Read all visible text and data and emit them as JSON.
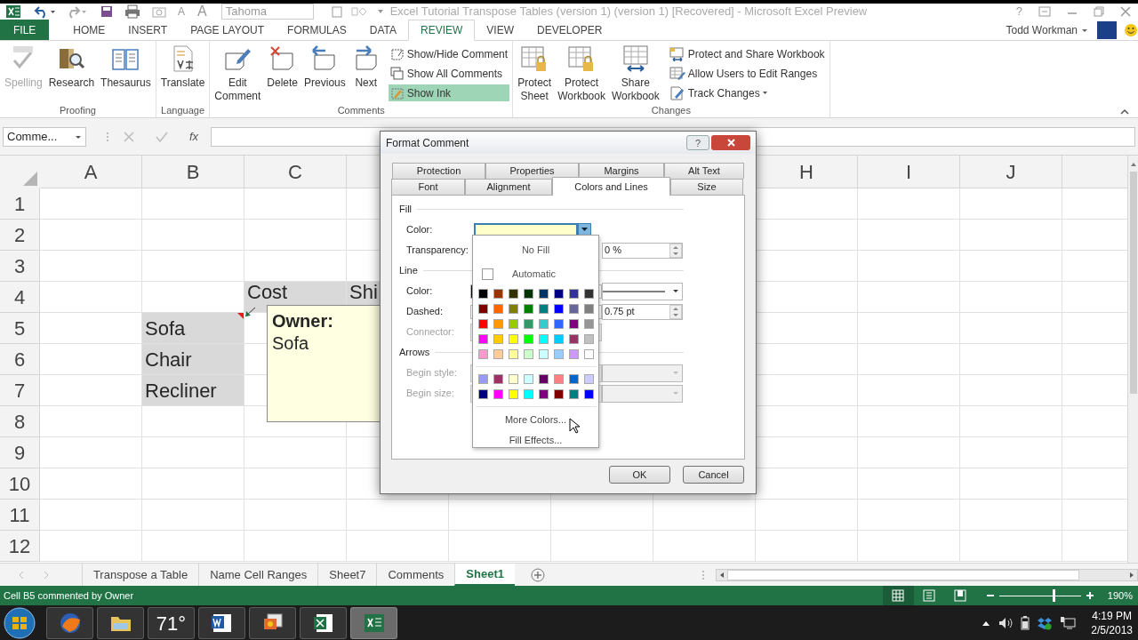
{
  "quick_access": {
    "font_shrink": "A",
    "font_grow": "A",
    "font_box": "Tahoma"
  },
  "window": {
    "title": "Excel Tutorial Transpose Tables (version 1) (version 1) [Recovered] - Microsoft Excel Preview",
    "help": "?"
  },
  "ribbon_tabs": [
    {
      "label": "FILE",
      "kind": "file",
      "selected": false
    },
    {
      "label": "HOME",
      "kind": "tab",
      "selected": false
    },
    {
      "label": "INSERT",
      "kind": "tab",
      "selected": false
    },
    {
      "label": "PAGE LAYOUT",
      "kind": "tab",
      "selected": false
    },
    {
      "label": "FORMULAS",
      "kind": "tab",
      "selected": false
    },
    {
      "label": "DATA",
      "kind": "tab",
      "selected": false
    },
    {
      "label": "REVIEW",
      "kind": "tab",
      "selected": true
    },
    {
      "label": "VIEW",
      "kind": "tab",
      "selected": false
    },
    {
      "label": "DEVELOPER",
      "kind": "tab",
      "selected": false
    }
  ],
  "account": {
    "user": "Todd Workman"
  },
  "ribbon_groups": [
    {
      "label": "Proofing",
      "buttons": [
        {
          "label": "Spelling",
          "kind": "spelling",
          "disabled": true
        },
        {
          "label": "Research",
          "kind": "research",
          "disabled": false
        },
        {
          "label": "Thesaurus",
          "kind": "thesaurus",
          "disabled": false
        }
      ]
    },
    {
      "label": "Language",
      "buttons": [
        {
          "label": "Translate",
          "kind": "translate",
          "disabled": false
        }
      ]
    },
    {
      "label": "Comments",
      "buttons": [
        {
          "label": "Edit Comment",
          "kind": "edit",
          "disabled": false
        },
        {
          "label": "Delete",
          "kind": "delete",
          "disabled": false
        },
        {
          "label": "Previous",
          "kind": "previous",
          "disabled": false
        },
        {
          "label": "Next",
          "kind": "next",
          "disabled": false
        }
      ],
      "small_buttons": [
        {
          "label": "Show/Hide Comment",
          "kind": "showhide",
          "on": false,
          "dropdown": false
        },
        {
          "label": "Show All Comments",
          "kind": "showall",
          "on": false,
          "dropdown": false
        },
        {
          "label": "Show Ink",
          "kind": "ink",
          "on": true,
          "dropdown": false
        }
      ]
    },
    {
      "label": "Changes",
      "buttons": [
        {
          "label": "Protect Sheet",
          "kind": "protect_sheet",
          "disabled": false
        },
        {
          "label": "Protect Workbook",
          "kind": "protect_book",
          "disabled": false
        },
        {
          "label": "Share Workbook",
          "kind": "share",
          "disabled": false
        }
      ],
      "small_buttons": [
        {
          "label": "Protect and Share Workbook",
          "kind": "protect_share",
          "on": false,
          "dropdown": false
        },
        {
          "label": "Allow Users to Edit Ranges",
          "kind": "ranges",
          "on": false,
          "dropdown": false
        },
        {
          "label": "Track Changes",
          "kind": "track",
          "on": false,
          "dropdown": true
        }
      ]
    }
  ],
  "formula_bar": {
    "name_box": "Comme...",
    "function_button": "fx"
  },
  "sheet": {
    "column_headers": [
      "A",
      "B",
      "C",
      "H",
      "I",
      "J"
    ],
    "rows": [
      {
        "header": "1",
        "cells": []
      },
      {
        "header": "2",
        "cells": []
      },
      {
        "header": "3",
        "cells": []
      },
      {
        "header": "4",
        "cells": [
          null,
          null,
          {
            "text": "Cost",
            "shaded": true,
            "comment_marker": false
          },
          {
            "text": "Shi",
            "shaded": true,
            "comment_marker": false
          }
        ]
      },
      {
        "header": "5",
        "cells": [
          null,
          {
            "text": "Sofa",
            "shaded": true,
            "comment_marker": true
          }
        ]
      },
      {
        "header": "6",
        "cells": [
          null,
          {
            "text": "Chair",
            "shaded": true,
            "comment_marker": false
          }
        ]
      },
      {
        "header": "7",
        "cells": [
          null,
          {
            "text": "Recliner",
            "shaded": true,
            "comment_marker": false
          }
        ]
      },
      {
        "header": "8",
        "cells": []
      },
      {
        "header": "9",
        "cells": []
      },
      {
        "header": "10",
        "cells": []
      },
      {
        "header": "11",
        "cells": []
      },
      {
        "header": "12",
        "cells": []
      }
    ],
    "comment": {
      "author": "Owner:",
      "text": "Sofa"
    }
  },
  "dialog": {
    "title": "Format Comment",
    "help": "?",
    "tab_rows": [
      [
        {
          "label": "Protection",
          "selected": false
        },
        {
          "label": "Properties",
          "selected": false
        },
        {
          "label": "Margins",
          "selected": false
        },
        {
          "label": "Alt Text",
          "selected": false
        }
      ],
      [
        {
          "label": "Font",
          "selected": false
        },
        {
          "label": "Alignment",
          "selected": false
        },
        {
          "label": "Colors and Lines",
          "selected": true
        },
        {
          "label": "Size",
          "selected": false
        }
      ]
    ],
    "fill": {
      "heading": "Fill",
      "color_label": "Color:",
      "color": "#ffffcc",
      "transparency_label": "Transparency:",
      "transparency": "0 %"
    },
    "line": {
      "heading": "Line",
      "color_label": "Color:",
      "dashed_label": "Dashed:",
      "weight": "0.75 pt",
      "connector_label": "Connector:",
      "connector_disabled": true
    },
    "arrows": {
      "heading": "Arrows",
      "begin_style_label": "Begin style:",
      "begin_size_label": "Begin size:",
      "disabled": true
    },
    "color_menu": {
      "no_fill": "No Fill",
      "automatic": "Automatic",
      "palette": [
        [
          {
            "color": "#000000"
          },
          {
            "color": "#993300"
          },
          {
            "color": "#333300"
          },
          {
            "color": "#003300"
          },
          {
            "color": "#003366"
          },
          {
            "color": "#000080"
          },
          {
            "color": "#333399"
          },
          {
            "color": "#333333"
          }
        ],
        [
          {
            "color": "#800000"
          },
          {
            "color": "#ff6600"
          },
          {
            "color": "#808000"
          },
          {
            "color": "#008000"
          },
          {
            "color": "#008080"
          },
          {
            "color": "#0000ff"
          },
          {
            "color": "#666699"
          },
          {
            "color": "#808080"
          }
        ],
        [
          {
            "color": "#ff0000"
          },
          {
            "color": "#ff9900"
          },
          {
            "color": "#99cc00"
          },
          {
            "color": "#339966"
          },
          {
            "color": "#33cccc"
          },
          {
            "color": "#3366ff"
          },
          {
            "color": "#800080"
          },
          {
            "color": "#969696"
          }
        ],
        [
          {
            "color": "#ff00ff"
          },
          {
            "color": "#ffcc00"
          },
          {
            "color": "#ffff00"
          },
          {
            "color": "#00ff00"
          },
          {
            "color": "#00ffff"
          },
          {
            "color": "#00ccff"
          },
          {
            "color": "#993366"
          },
          {
            "color": "#c0c0c0"
          }
        ],
        [
          {
            "color": "#ff99cc"
          },
          {
            "color": "#ffcc99"
          },
          {
            "color": "#ffff99"
          },
          {
            "color": "#ccffcc"
          },
          {
            "color": "#ccffff"
          },
          {
            "color": "#99ccff"
          },
          {
            "color": "#cc99ff"
          },
          {
            "color": "#ffffff"
          }
        ]
      ],
      "recent": [
        [
          {
            "color": "#9999ff"
          },
          {
            "color": "#993366"
          },
          {
            "color": "#ffffcc"
          },
          {
            "color": "#ccffff"
          },
          {
            "color": "#660066"
          },
          {
            "color": "#ff8080"
          },
          {
            "color": "#0066cc"
          },
          {
            "color": "#ccccff"
          }
        ],
        [
          {
            "color": "#000080"
          },
          {
            "color": "#ff00ff"
          },
          {
            "color": "#ffff00"
          },
          {
            "color": "#00ffff"
          },
          {
            "color": "#800080"
          },
          {
            "color": "#800000"
          },
          {
            "color": "#008080"
          },
          {
            "color": "#0000ff"
          }
        ]
      ],
      "more": "More Colors...",
      "fill_effects": "Fill Effects..."
    },
    "buttons": [
      "OK",
      "Cancel"
    ]
  },
  "sheet_tabs": [
    {
      "label": "Transpose a Table",
      "selected": false
    },
    {
      "label": "Name Cell Ranges",
      "selected": false
    },
    {
      "label": "Sheet7",
      "selected": false
    },
    {
      "label": "Comments",
      "selected": false
    },
    {
      "label": "Sheet1",
      "selected": true
    }
  ],
  "status_bar": {
    "message": "Cell B5 commented by Owner",
    "views": [
      {
        "kind": "normal",
        "selected": true
      },
      {
        "kind": "page_layout",
        "selected": false
      },
      {
        "kind": "page_break",
        "selected": false
      }
    ],
    "zoom": {
      "level": 0.65,
      "reading": "190%"
    }
  },
  "taskbar": {
    "items": [
      {
        "kind": "browser",
        "active": false
      },
      {
        "kind": "folder",
        "active": false
      },
      {
        "kind": "weather",
        "text": "71°",
        "active": false
      },
      {
        "kind": "word",
        "active": false
      },
      {
        "kind": "photos",
        "active": false
      },
      {
        "kind": "sheet_old",
        "active": false
      },
      {
        "kind": "sheet",
        "active": true
      }
    ],
    "clock": {
      "time": "4:19 PM",
      "date": "2/5/2013"
    }
  }
}
